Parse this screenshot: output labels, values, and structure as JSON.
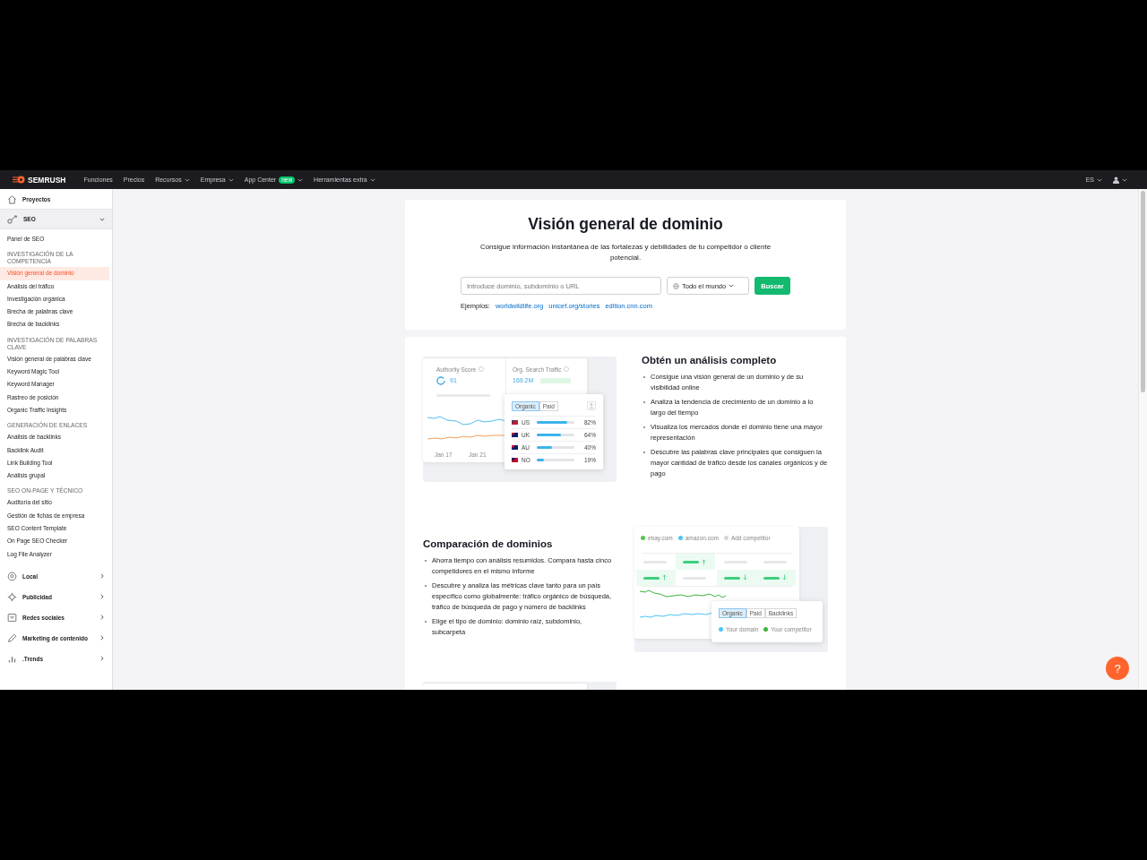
{
  "nav": {
    "logo": "SEMRUSH",
    "links": [
      {
        "label": "Funciones",
        "dropdown": false
      },
      {
        "label": "Precios",
        "dropdown": false
      },
      {
        "label": "Recursos",
        "dropdown": true
      },
      {
        "label": "Empresa",
        "dropdown": true
      },
      {
        "label": "App Center",
        "badge": "new",
        "dropdown": true
      },
      {
        "label": "Herramientas extra",
        "dropdown": true
      }
    ],
    "language": "ES"
  },
  "sidebar": {
    "top": {
      "label": "Proyectos"
    },
    "section": {
      "label": "SEO",
      "expanded": true,
      "items": [
        {
          "kind": "link",
          "label": "Panel de SEO",
          "selected": false
        },
        {
          "kind": "group",
          "label": "INVESTIGACIÓN DE LA COMPETENCIA"
        },
        {
          "kind": "link",
          "label": "Visión general de dominio",
          "selected": true
        },
        {
          "kind": "link",
          "label": "Análisis del tráfico",
          "selected": false
        },
        {
          "kind": "link",
          "label": "Investigación orgánica",
          "selected": false
        },
        {
          "kind": "link",
          "label": "Brecha de palabras clave",
          "selected": false
        },
        {
          "kind": "link",
          "label": "Brecha de backlinks",
          "selected": false
        },
        {
          "kind": "group",
          "label": "INVESTIGACIÓN DE PALABRAS CLAVE"
        },
        {
          "kind": "link",
          "label": "Visión general de palabras clave",
          "selected": false
        },
        {
          "kind": "link",
          "label": "Keyword Magic Tool",
          "selected": false
        },
        {
          "kind": "link",
          "label": "Keyword Manager",
          "selected": false
        },
        {
          "kind": "link",
          "label": "Rastreo de posición",
          "selected": false
        },
        {
          "kind": "link",
          "label": "Organic Traffic Insights",
          "selected": false
        },
        {
          "kind": "group",
          "label": "GENERACIÓN DE ENLACES"
        },
        {
          "kind": "link",
          "label": "Análisis de backlinks",
          "selected": false
        },
        {
          "kind": "link",
          "label": "Backlink Audit",
          "selected": false
        },
        {
          "kind": "link",
          "label": "Link Building Tool",
          "selected": false
        },
        {
          "kind": "link",
          "label": "Análisis grupal",
          "selected": false
        },
        {
          "kind": "group",
          "label": "SEO ON-PAGE Y TÉCNICO"
        },
        {
          "kind": "link",
          "label": "Auditoría del sitio",
          "selected": false
        },
        {
          "kind": "link",
          "label": "Gestión de fichas de empresa",
          "selected": false
        },
        {
          "kind": "link",
          "label": "SEO Content Template",
          "selected": false
        },
        {
          "kind": "link",
          "label": "On Page SEO Checker",
          "selected": false
        },
        {
          "kind": "link",
          "label": "Log File Analyzer",
          "selected": false
        }
      ]
    },
    "more": [
      {
        "label": "Local"
      },
      {
        "label": "Publicidad"
      },
      {
        "label": "Redes sociales"
      },
      {
        "label": "Marketing de contenido"
      },
      {
        "label": ".Trends"
      }
    ]
  },
  "hero": {
    "title": "Visión general de dominio",
    "subtitle": "Consigue información instantánea de las fortalezas y debilidades de tu competidor o cliente potencial.",
    "search": {
      "placeholder": "Introduce dominio, subdominio o URL"
    },
    "region": "Todo el mundo",
    "button": "Buscar",
    "examples_label": "Ejemplos:",
    "examples": [
      "worldwildlife.org",
      "unicef.org/stories",
      "edition.cnn.com"
    ]
  },
  "features": [
    {
      "kind": "overview",
      "title": "Obtén un análisis completo",
      "bullets": [
        "Consigue una visión general de un dominio y de su visibilidad online",
        "Analiza la tendencia de crecimiento de un dominio a lo largo del tiempo",
        "Visualiza los mercados donde el dominio tiene una mayor representación",
        "Descubre las palabras clave principales que consiguen la mayor cantidad de tráfico desde los canales orgánicos y de pago"
      ],
      "illustration": {
        "metrics": [
          {
            "label": "Authority Score",
            "value": "91"
          },
          {
            "label": "Org. Search Traffic",
            "value": "169.2M"
          }
        ],
        "dates": [
          "Jan 17",
          "Jan 21"
        ],
        "tabs": [
          {
            "label": "Organic",
            "selected": true
          },
          {
            "label": "Paid",
            "selected": false
          }
        ],
        "countries": [
          {
            "code": "US",
            "level": 0.82,
            "percent": "82%"
          },
          {
            "code": "UK",
            "level": 0.64,
            "percent": "64%"
          },
          {
            "code": "AU",
            "level": 0.4,
            "percent": "40%"
          },
          {
            "code": "NO",
            "level": 0.19,
            "percent": "19%"
          }
        ]
      }
    },
    {
      "kind": "comparison",
      "title": "Comparación de dominios",
      "bullets": [
        "Ahorra tiempo con análisis resumidos. Compara hasta cinco competidores en el mismo informe",
        "Descubre y analiza las métricas clave tanto para un país específico como globalmente: tráfico orgánico de búsqueda, tráfico de búsqueda de pago y número de backlinks",
        "Elige el tipo de dominio: dominio raíz, subdominio, subcarpeta"
      ],
      "illustration": {
        "legend": [
          {
            "label": "ebay.com",
            "color": "#5cc151"
          },
          {
            "label": "amazon.com",
            "color": "#4cc3f5"
          },
          {
            "label": "Add competitor",
            "color": "#d5d5d8"
          }
        ],
        "tabs": [
          {
            "label": "Organic",
            "selected": true
          },
          {
            "label": "Paid",
            "selected": false
          },
          {
            "label": "Backlinks",
            "selected": false
          }
        ],
        "series": [
          {
            "label": "Your domain",
            "color": "#4cc3f5"
          },
          {
            "label": "Your competitor",
            "color": "#3fb23a"
          }
        ]
      }
    }
  ],
  "help": "?"
}
